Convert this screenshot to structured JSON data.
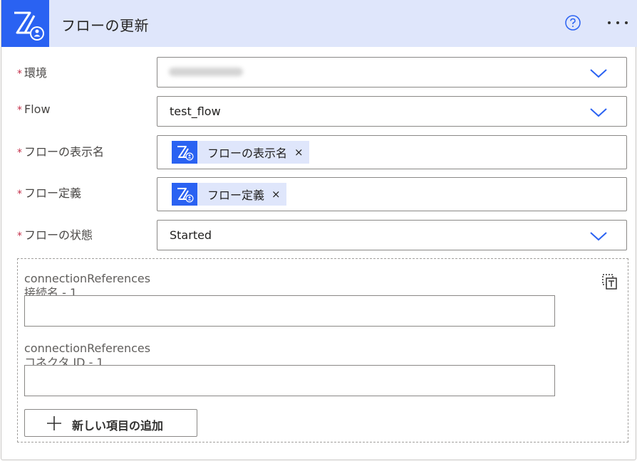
{
  "header": {
    "title": "フローの更新",
    "icon": "power-automate-flow-icon",
    "help_icon": "help-circle-icon",
    "more_icon": "more-ellipsis-icon",
    "accent_color": "#2a62f2",
    "header_bg": "#dfe6fb"
  },
  "required_marker": "*",
  "fields": {
    "environment": {
      "label": "環境",
      "value": ""
    },
    "flow": {
      "label": "Flow",
      "value": "test_flow"
    },
    "display_name": {
      "label": "フローの表示名",
      "token": "フローの表示名",
      "remove": "×"
    },
    "definition": {
      "label": "フロー定義",
      "token": "フロー定義",
      "remove": "×"
    },
    "state": {
      "label": "フローの状態",
      "value": "Started"
    }
  },
  "connection_references": {
    "items": [
      {
        "label_line1": "connectionReferences",
        "label_line2": "接続名 - 1",
        "value": ""
      },
      {
        "label_line1": "connectionReferences",
        "label_line2": "コネクタ ID - 1",
        "value": ""
      }
    ],
    "add_button": "新しい項目の追加",
    "toggle_icon": "switch-to-text-input-icon"
  }
}
